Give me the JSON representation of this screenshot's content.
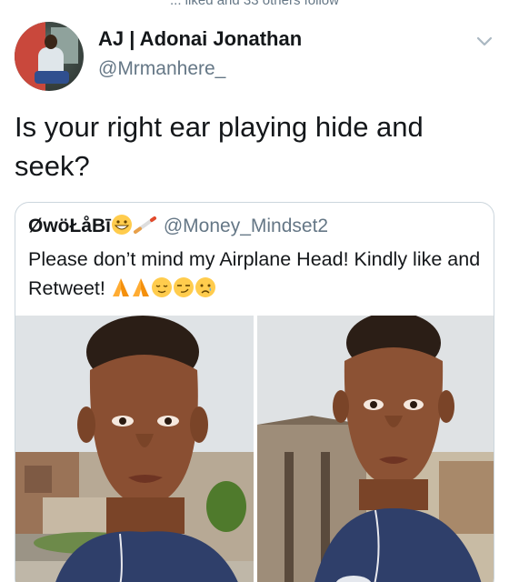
{
  "context": {
    "text": "... liked and 33 others follow"
  },
  "author": {
    "display_name": "AJ | Adonai Jonathan",
    "username": "@Mrmanhere_"
  },
  "tweet": {
    "text": "Is your right ear playing hide and seek?"
  },
  "quoted_tweet": {
    "display_name": "ØwöŁåBī",
    "username": "@Money_Mindset2",
    "text": "Please don’t mind my Airplane Head! Kindly like and Retweet!",
    "name_emojis": [
      "grinning-face-icon",
      "cigarette-icon"
    ],
    "text_emojis": [
      "folded-hands-icon",
      "folded-hands-icon",
      "relieved-face-icon",
      "smirking-face-icon",
      "sad-face-icon"
    ],
    "media_count": 2
  },
  "icons": {
    "caret": "chevron-down-icon"
  },
  "colors": {
    "text_primary": "#14171a",
    "text_secondary": "#657786",
    "border": "#ccd6dd",
    "emoji_yellow": "#ffcc4d"
  }
}
